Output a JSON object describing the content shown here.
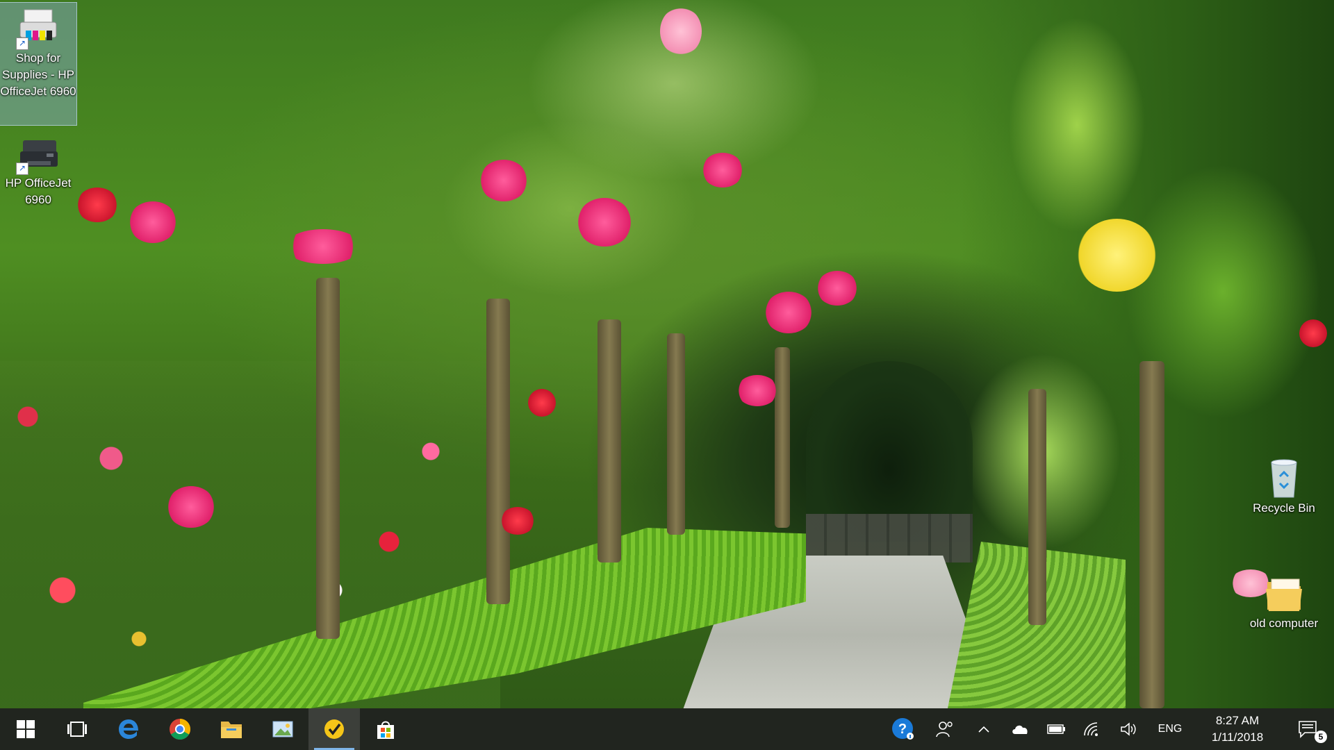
{
  "desktop": {
    "icons": [
      {
        "label": "Shop for Supplies - HP OfficeJet 6960",
        "icon": "printer-supplies-icon"
      },
      {
        "label": "HP OfficeJet 6960",
        "icon": "printer-icon"
      },
      {
        "label": "Recycle Bin",
        "icon": "recycle-bin-icon"
      },
      {
        "label": "old computer",
        "icon": "folder-icon"
      }
    ]
  },
  "taskbar": {
    "apps": [
      {
        "name": "start",
        "icon": "windows-start-icon"
      },
      {
        "name": "task-view",
        "icon": "task-view-icon"
      },
      {
        "name": "edge",
        "icon": "edge-icon"
      },
      {
        "name": "chrome",
        "icon": "chrome-icon"
      },
      {
        "name": "file-explorer",
        "icon": "folder-icon"
      },
      {
        "name": "photos",
        "icon": "photos-icon"
      },
      {
        "name": "norton",
        "icon": "norton-icon"
      },
      {
        "name": "store",
        "icon": "store-icon"
      }
    ],
    "tray": {
      "language": "ENG",
      "time": "8:27 AM",
      "date": "1/11/2018",
      "notification_count": "5"
    }
  },
  "colors": {
    "taskbar_bg": "#10140e",
    "accent": "#7fb5e8"
  }
}
